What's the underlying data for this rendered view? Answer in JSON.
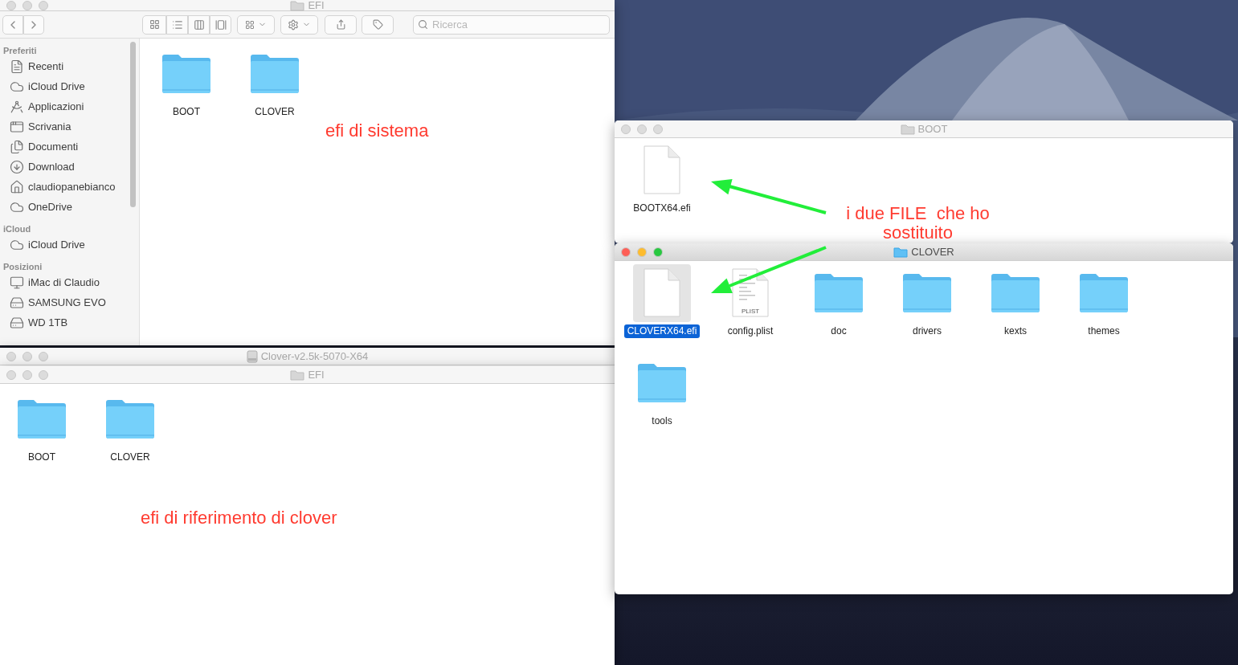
{
  "windows": [
    {
      "kind": "browser",
      "title": "EFI",
      "active": false,
      "search": {
        "placeholder": "Ricerca"
      },
      "sidebar": [
        {
          "heading": "Preferiti",
          "items": [
            {
              "label": "Recenti"
            },
            {
              "label": "iCloud Drive"
            },
            {
              "label": "Applicazioni"
            },
            {
              "label": "Scrivania"
            },
            {
              "label": "Documenti"
            },
            {
              "label": "Download"
            },
            {
              "label": "claudiopanebianco"
            },
            {
              "label": "OneDrive"
            }
          ]
        },
        {
          "heading": "iCloud",
          "items": [
            {
              "label": "iCloud Drive"
            }
          ]
        },
        {
          "heading": "Posizioni",
          "items": [
            {
              "label": "iMac di Claudio"
            },
            {
              "label": "SAMSUNG EVO"
            },
            {
              "label": "WD 1TB"
            }
          ]
        }
      ],
      "items": [
        {
          "kind": "folder",
          "name": "BOOT",
          "selected": false
        },
        {
          "kind": "folder",
          "name": "CLOVER",
          "selected": false
        }
      ]
    },
    {
      "kind": "titlebar",
      "title": "Clover-v2.5k-5070-X64",
      "active": false
    },
    {
      "kind": "icons",
      "title": "EFI",
      "active": false,
      "items": [
        {
          "kind": "folder",
          "name": "BOOT",
          "selected": false
        },
        {
          "kind": "folder",
          "name": "CLOVER",
          "selected": false
        }
      ]
    },
    {
      "kind": "icons",
      "title": "BOOT",
      "active": false,
      "items": [
        {
          "kind": "file",
          "name": "BOOTX64.efi",
          "selected": false
        }
      ]
    },
    {
      "kind": "icons",
      "title": "CLOVER",
      "active": true,
      "items": [
        {
          "kind": "file",
          "name": "CLOVERX64.efi",
          "selected": true
        },
        {
          "kind": "plist",
          "name": "config.plist",
          "badge": "PLIST",
          "selected": false
        },
        {
          "kind": "folder",
          "name": "doc",
          "selected": false
        },
        {
          "kind": "folder",
          "name": "drivers",
          "selected": false
        },
        {
          "kind": "folder",
          "name": "kexts",
          "selected": false
        },
        {
          "kind": "folder",
          "name": "themes",
          "selected": false
        },
        {
          "kind": "folder",
          "name": "tools",
          "selected": false
        }
      ]
    }
  ],
  "annotations": [
    {
      "text": "efi di sistema"
    },
    {
      "text": "efi di riferimento di clover"
    },
    {
      "text": "i due FILE  che ho sostituito"
    }
  ]
}
